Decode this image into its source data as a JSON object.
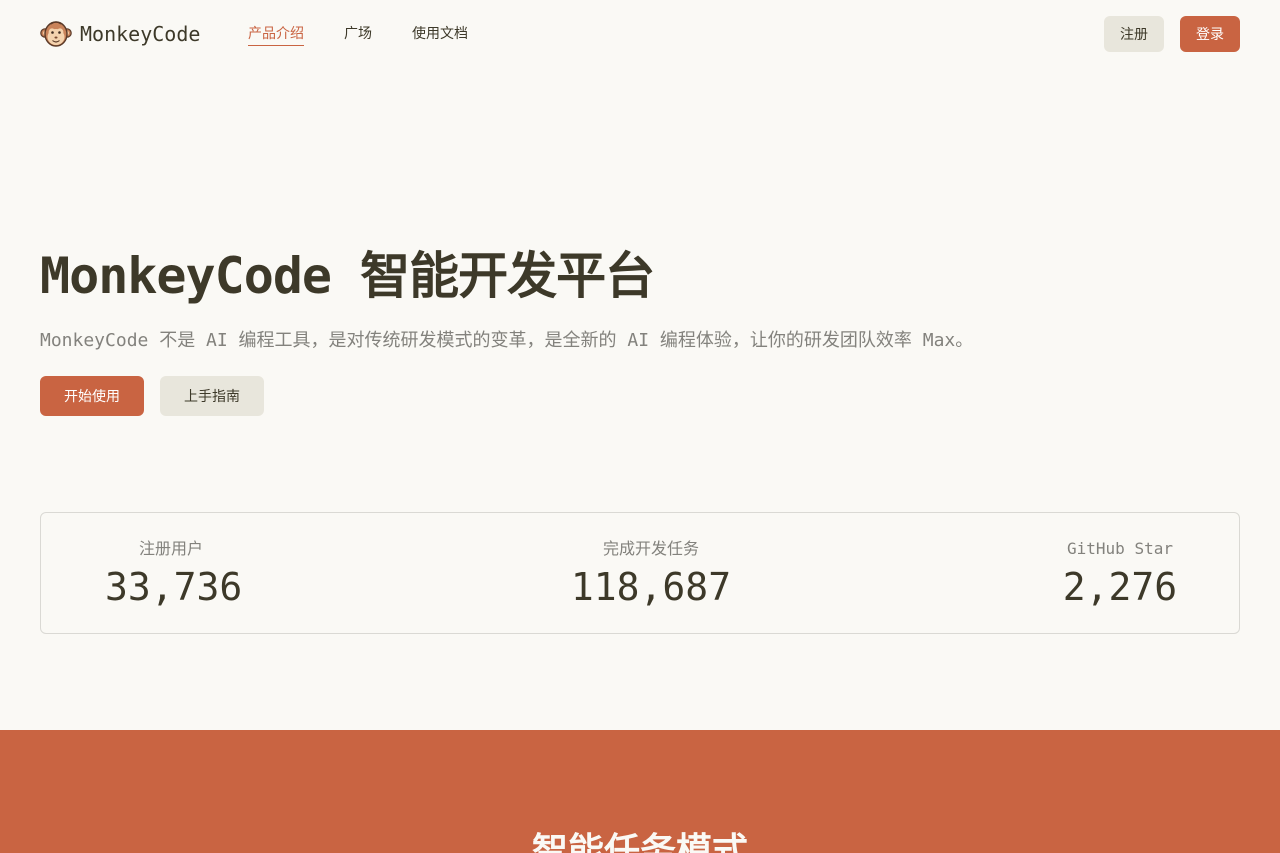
{
  "header": {
    "logo_text": "MonkeyCode",
    "nav": [
      {
        "label": "产品介绍",
        "active": true
      },
      {
        "label": "广场",
        "active": false
      },
      {
        "label": "使用文档",
        "active": false
      }
    ],
    "register_label": "注册",
    "login_label": "登录"
  },
  "hero": {
    "title": "MonkeyCode 智能开发平台",
    "subtitle": "MonkeyCode 不是 AI 编程工具，是对传统研发模式的变革，是全新的 AI 编程体验，让你的研发团队效率 Max。",
    "start_label": "开始使用",
    "guide_label": "上手指南"
  },
  "stats": [
    {
      "label": "注册用户",
      "value": "33,736"
    },
    {
      "label": "完成开发任务",
      "value": "118,687"
    },
    {
      "label": "GitHub Star",
      "value": "2,276"
    }
  ],
  "section": {
    "title": "智能任务模式"
  },
  "colors": {
    "accent": "#c96442",
    "background": "#faf9f5",
    "text": "#3d3929",
    "muted": "#83827d",
    "secondary_button": "#e8e6dc"
  },
  "icons": {
    "logo": "monkey-face-icon"
  }
}
